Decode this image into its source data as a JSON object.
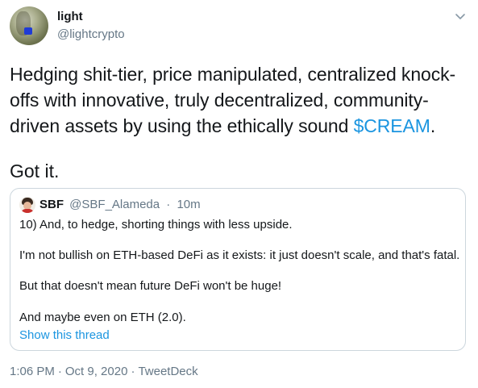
{
  "author": {
    "display_name": "light",
    "handle": "@lightcrypto"
  },
  "tweet": {
    "text_before": "Hedging shit-tier, price manipulated, centralized knock-offs with innovative, truly decentralized, community-driven assets by using the ethically sound ",
    "cashtag": "$CREAM",
    "text_after": ".",
    "second_paragraph": "Got it."
  },
  "quoted_tweet": {
    "display_name": "SBF",
    "handle": "@SBF_Alameda",
    "separator": "·",
    "time": "10m",
    "lines": [
      "10) And, to hedge, shorting things with less upside.",
      "I'm not bullish on ETH-based DeFi as it exists: it just doesn't scale, and that's fatal.",
      "But that doesn't mean future DeFi won't be huge!",
      "And maybe even on ETH (2.0)."
    ],
    "show_thread": "Show this thread"
  },
  "meta": {
    "time": "1:06 PM",
    "date": "Oct 9, 2020",
    "separator": "·",
    "source": "TweetDeck"
  },
  "colors": {
    "link": "#1b95e0",
    "secondary_text": "#657786",
    "border": "#ccd6dd",
    "primary_text": "#14171a"
  },
  "icons": {
    "caret": "chevron-down-icon"
  }
}
